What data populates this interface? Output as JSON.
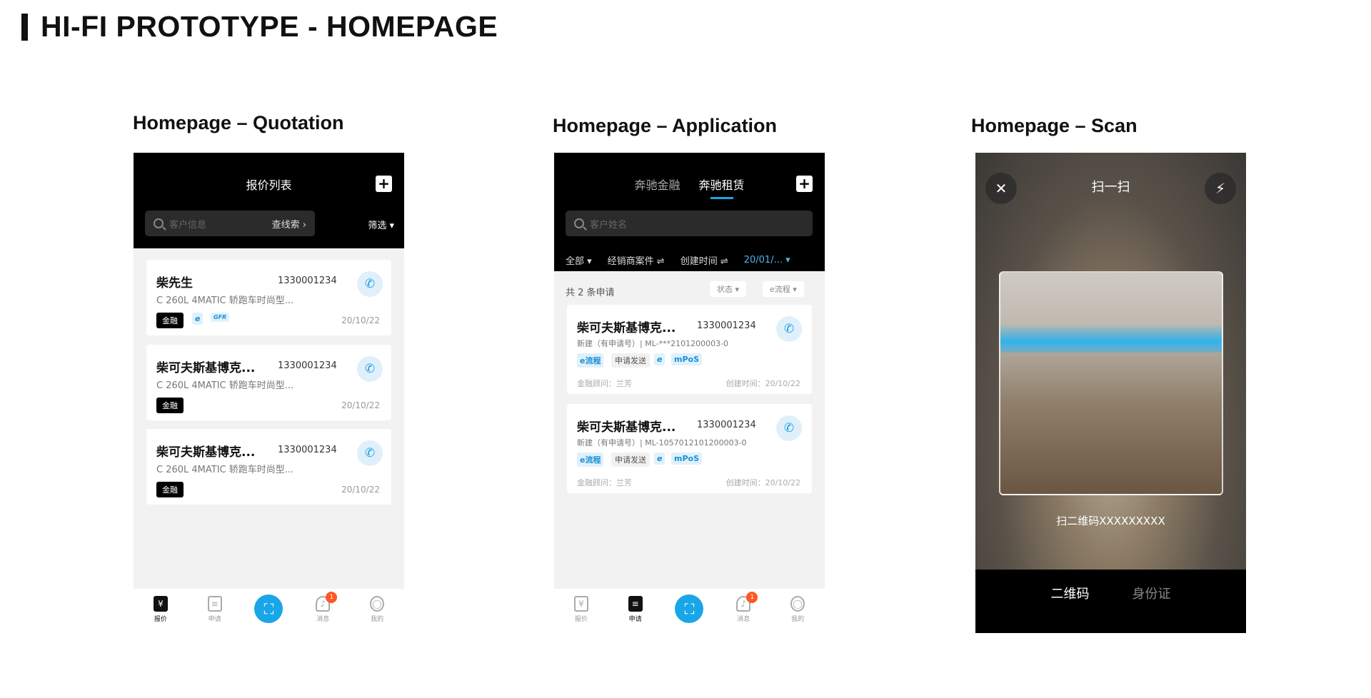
{
  "page": {
    "title": "HI-FI PROTOTYPE - HOMEPAGE"
  },
  "sections": {
    "quotation": "Homepage – Quotation",
    "application": "Homepage – Application",
    "scan": "Homepage – Scan"
  },
  "quotation": {
    "header_title": "报价列表",
    "plus": "+",
    "search_placeholder": "客户信息",
    "search_right": "查线索 ›",
    "filter": "筛选 ▾",
    "cards": [
      {
        "name": "柴先生",
        "phone": "1330001234",
        "desc": "C 260L 4MATIC 轿跑车时尚型...",
        "tag": "金融",
        "tag2": "e",
        "tag3": "GFR",
        "date": "20/10/22"
      },
      {
        "name": "柴可夫斯基博克...",
        "phone": "1330001234",
        "desc": "C 260L 4MATIC 轿跑车时尚型...",
        "tag": "金融",
        "date": "20/10/22"
      },
      {
        "name": "柴可夫斯基博克...",
        "phone": "1330001234",
        "desc": "C 260L 4MATIC 轿跑车时尚型...",
        "tag": "金融",
        "date": "20/10/22"
      }
    ],
    "nav": [
      {
        "label": "报价",
        "icon": "¥"
      },
      {
        "label": "申请",
        "icon": "≡"
      },
      {
        "label": "",
        "icon": "⛶"
      },
      {
        "label": "消息",
        "icon": "♪",
        "badge": "1"
      },
      {
        "label": "我的",
        "icon": "◯"
      }
    ]
  },
  "application": {
    "tab1": "奔驰金融",
    "tab2": "奔驰租赁",
    "plus": "+",
    "search_placeholder": "客户姓名",
    "filters": [
      "全部 ▾",
      "经销商案件 ⇌",
      "创建时间 ⇌",
      "20/01/... ▾"
    ],
    "count": "共 2 条申请",
    "status_filter": "状态 ▾",
    "flow_filter": "e流程 ▾",
    "cards": [
      {
        "name": "柴可夫斯基博克...",
        "phone": "1330001234",
        "line2": "新建（有申请号）| ML-***2101200003-0",
        "tags": [
          "e流程",
          "申请发送",
          "e",
          "mPoS"
        ],
        "advisor": "金融顾问：兰芳",
        "created": "创建时间：20/10/22"
      },
      {
        "name": "柴可夫斯基博克...",
        "phone": "1330001234",
        "line2": "新建（有申请号）| ML-1057012101200003-0",
        "tags": [
          "e流程",
          "申请发送",
          "e",
          "mPoS"
        ],
        "advisor": "金融顾问：兰芳",
        "created": "创建时间：20/10/22"
      }
    ],
    "nav": [
      {
        "label": "报价",
        "icon": "¥"
      },
      {
        "label": "申请",
        "icon": "≡"
      },
      {
        "label": "",
        "icon": "⛶"
      },
      {
        "label": "消息",
        "icon": "♪",
        "badge": "1"
      },
      {
        "label": "我的",
        "icon": "◯"
      }
    ]
  },
  "scan": {
    "title": "扫一扫",
    "close": "✕",
    "flash": "⚡",
    "caption": "扫二维码XXXXXXXXX",
    "tab1": "二维码",
    "tab2": "身份证"
  },
  "colors": {
    "accent": "#19a6e8",
    "badge": "#ff5722",
    "bar": "#000000"
  }
}
